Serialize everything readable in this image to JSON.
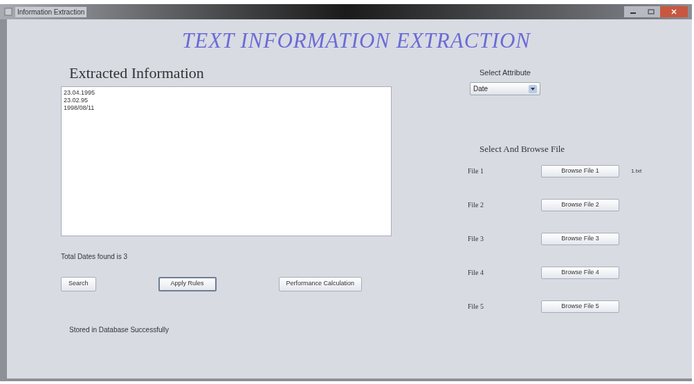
{
  "window": {
    "title": "Information Extraction"
  },
  "heading": "TEXT INFORMATION EXTRACTION",
  "extracted": {
    "title": "Extracted Information",
    "lines": [
      "23.04.1995",
      "23.02.95",
      "1998/08/11"
    ],
    "total": "Total Dates found is 3"
  },
  "buttons": [
    {
      "label": "Search",
      "focused": false
    },
    {
      "label": "Apply Rules",
      "focused": true
    },
    {
      "label": "Performance Calculation",
      "focused": false
    }
  ],
  "status": "Stored in Database Successfully",
  "attribute": {
    "label": "Select Attribute",
    "value": "Date"
  },
  "browse": {
    "title": "Select And Browse File",
    "files": [
      {
        "label": "File 1",
        "button": "Browse File 1",
        "file": "1.txt"
      },
      {
        "label": "File 2",
        "button": "Browse File 2"
      },
      {
        "label": "File 3",
        "button": "Browse File 3"
      },
      {
        "label": "File 4",
        "button": "Browse File 4"
      },
      {
        "label": "File 5",
        "button": "Browse File 5"
      }
    ]
  }
}
